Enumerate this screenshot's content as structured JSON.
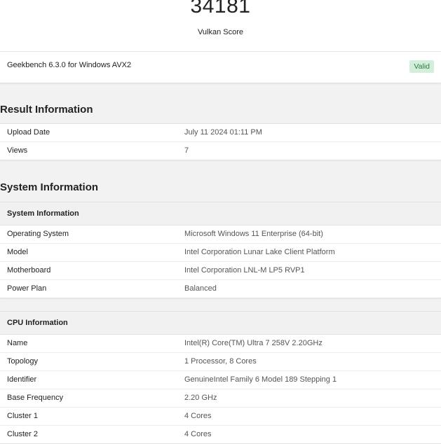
{
  "score": {
    "value": "34181",
    "label": "Vulkan Score"
  },
  "benchmark": {
    "version": "Geekbench 6.3.0 for Windows AVX2",
    "status_badge": "Valid"
  },
  "result_information": {
    "heading": "Result Information",
    "rows": [
      {
        "label": "Upload Date",
        "value": "July 11 2024 01:11 PM"
      },
      {
        "label": "Views",
        "value": "7"
      }
    ]
  },
  "system_information": {
    "heading": "System Information",
    "system_card": {
      "title": "System Information",
      "rows": [
        {
          "label": "Operating System",
          "value": "Microsoft Windows 11 Enterprise (64-bit)"
        },
        {
          "label": "Model",
          "value": "Intel Corporation Lunar Lake Client Platform"
        },
        {
          "label": "Motherboard",
          "value": "Intel Corporation LNL-M LP5 RVP1"
        },
        {
          "label": "Power Plan",
          "value": "Balanced"
        }
      ]
    },
    "cpu_card": {
      "title": "CPU Information",
      "rows": [
        {
          "label": "Name",
          "value": "Intel(R) Core(TM) Ultra 7 258V 2.20GHz"
        },
        {
          "label": "Topology",
          "value": "1 Processor, 8 Cores"
        },
        {
          "label": "Identifier",
          "value": "GenuineIntel Family 6 Model 189 Stepping 1"
        },
        {
          "label": "Base Frequency",
          "value": "2.20 GHz"
        },
        {
          "label": "Cluster 1",
          "value": "4 Cores"
        },
        {
          "label": "Cluster 2",
          "value": "4 Cores"
        }
      ]
    }
  },
  "colors": {
    "page_background": "#f2f2f2",
    "card_background": "#ffffff",
    "card_header_background": "#f1f1f1",
    "valid_badge_background": "#d4eedc",
    "valid_badge_text": "#2a7a3f",
    "value_text": "#555555"
  }
}
